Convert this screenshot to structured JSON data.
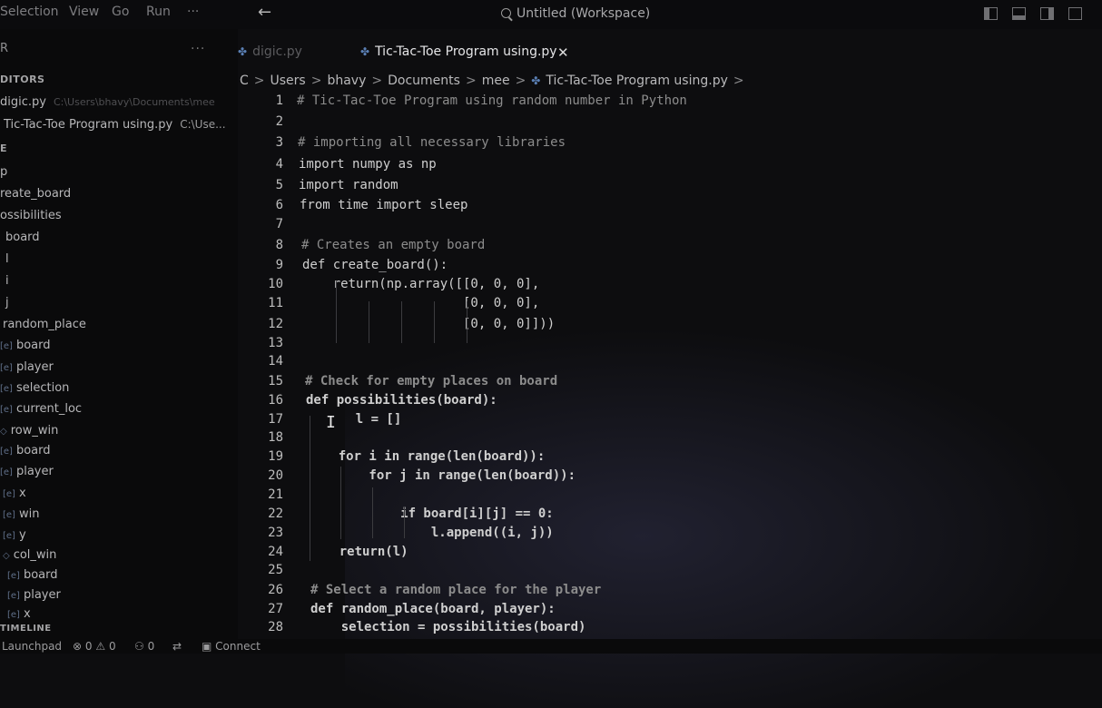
{
  "menu": [
    "Selection",
    "View",
    "Go",
    "Run",
    "···"
  ],
  "workspace_title": "Untitled (Workspace)",
  "sidebar": {
    "explorer_label": "R",
    "editors_header": "DITORS",
    "open_editors": [
      {
        "name": "digic.py",
        "path": "C:\\Users\\bhavy\\Documents\\mee"
      },
      {
        "name": "Tic-Tac-Toe Program using.py",
        "path": "C:\\Use..."
      }
    ],
    "outline_header": "E",
    "outline": [
      "p",
      "reate_board",
      "ossibilities",
      "board",
      "l",
      "i",
      "j",
      "random_place",
      "board",
      "player",
      "selection",
      "current_loc",
      "row_win",
      "board",
      "player",
      "x",
      "win",
      "y",
      "col_win",
      "board",
      "player",
      "x"
    ],
    "timeline_header": "TIMELINE"
  },
  "tabs": [
    {
      "label": "digic.py",
      "active": false
    },
    {
      "label": "Tic-Tac-Toe Program using.py",
      "active": true
    }
  ],
  "breadcrumb": [
    "C",
    "Users",
    "bhavy",
    "Documents",
    "mee",
    "Tic-Tac-Toe Program using.py"
  ],
  "code_lines": [
    {
      "n": "1",
      "text": "# Tic-Tac-Toe Program using random number in Python",
      "kind": "comment"
    },
    {
      "n": "2",
      "text": "",
      "kind": "text"
    },
    {
      "n": "3",
      "text": "# importing all necessary libraries",
      "kind": "comment"
    },
    {
      "n": "4",
      "text": "import numpy as np",
      "kind": "text"
    },
    {
      "n": "5",
      "text": "import random",
      "kind": "text"
    },
    {
      "n": "6",
      "text": "from time import sleep",
      "kind": "text"
    },
    {
      "n": "7",
      "text": "",
      "kind": "text"
    },
    {
      "n": "8",
      "text": "# Creates an empty board",
      "kind": "comment"
    },
    {
      "n": "9",
      "text": "def create_board():",
      "kind": "text"
    },
    {
      "n": "10",
      "text": "    return(np.array([[0, 0, 0],",
      "kind": "text"
    },
    {
      "n": "11",
      "text": "                     [0, 0, 0],",
      "kind": "text"
    },
    {
      "n": "12",
      "text": "                     [0, 0, 0]]))",
      "kind": "text"
    },
    {
      "n": "13",
      "text": "",
      "kind": "text"
    },
    {
      "n": "14",
      "text": "",
      "kind": "text"
    },
    {
      "n": "15",
      "text": "# Check for empty places on board",
      "kind": "comment"
    },
    {
      "n": "16",
      "text": "def possibilities(board):",
      "kind": "text"
    },
    {
      "n": "17",
      "text": "    l = []",
      "kind": "text"
    },
    {
      "n": "18",
      "text": "",
      "kind": "text"
    },
    {
      "n": "19",
      "text": "    for i in range(len(board)):",
      "kind": "text"
    },
    {
      "n": "20",
      "text": "        for j in range(len(board)):",
      "kind": "text"
    },
    {
      "n": "21",
      "text": "",
      "kind": "text"
    },
    {
      "n": "22",
      "text": "            if board[i][j] == 0:",
      "kind": "text"
    },
    {
      "n": "23",
      "text": "                l.append((i, j))",
      "kind": "text"
    },
    {
      "n": "24",
      "text": "    return(l)",
      "kind": "text"
    },
    {
      "n": "25",
      "text": "",
      "kind": "text"
    },
    {
      "n": "26",
      "text": "# Select a random place for the player",
      "kind": "comment"
    },
    {
      "n": "27",
      "text": "def random_place(board, player):",
      "kind": "text"
    },
    {
      "n": "28",
      "text": "    selection = possibilities(board)",
      "kind": "text"
    }
  ],
  "statusbar": {
    "launchpad": "Launchpad",
    "errors": "0",
    "warnings": "0",
    "ports": "0",
    "connect": "Connect"
  }
}
